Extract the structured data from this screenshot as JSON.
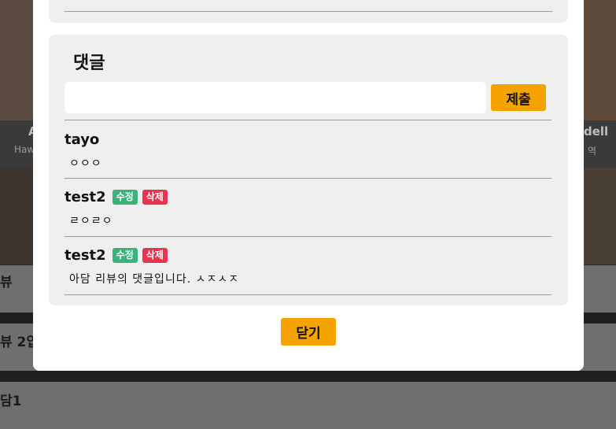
{
  "background": {
    "left_card": {
      "name": "A",
      "subtitle": "Haw"
    },
    "right_card": {
      "name": "dell",
      "subtitle": "역"
    },
    "rows": [
      "뷰",
      "뷰 2입",
      "담1"
    ]
  },
  "modal": {
    "comments": {
      "title": "댓글",
      "input_placeholder": "",
      "input_value": "",
      "submit_label": "제출",
      "items": [
        {
          "author": "tayo",
          "text": "ㅇㅇㅇ",
          "editable": false
        },
        {
          "author": "test2",
          "text": "ㄹㅇㄹㅇ",
          "editable": true,
          "edit_label": "수정",
          "delete_label": "삭제"
        },
        {
          "author": "test2",
          "text": "아담 리뷰의 댓글입니다. ㅅㅈㅅㅈ",
          "editable": true,
          "edit_label": "수정",
          "delete_label": "삭제"
        }
      ]
    },
    "close_label": "닫기"
  },
  "colors": {
    "accent": "#f5a300",
    "edit_tag": "#3bb27a",
    "delete_tag": "#e8344e",
    "card_bg": "#efefef"
  }
}
